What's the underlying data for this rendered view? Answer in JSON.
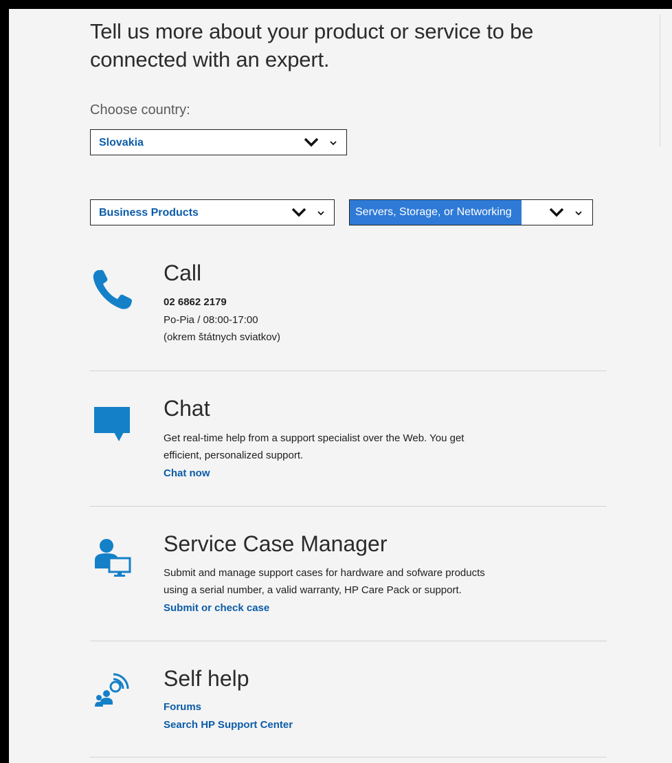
{
  "headline": "Tell us more about your product or service to be connected with an expert.",
  "country": {
    "label": "Choose country:",
    "selected": "Slovakia"
  },
  "product_select": {
    "selected": "Business Products"
  },
  "category_select": {
    "selected": "Servers, Storage, or Networking"
  },
  "call": {
    "title": "Call",
    "phone": "02 6862 2179",
    "hours": "Po-Pia / 08:00-17:00",
    "note": "(okrem štátnych sviatkov)",
    "icon": "phone-icon"
  },
  "chat": {
    "title": "Chat",
    "description_line1": "Get real-time help from a support specialist over the Web. You get",
    "description_line2": "efficient, personalized support.",
    "link": "Chat now",
    "icon": "chat-bubble-icon"
  },
  "service_case": {
    "title": "Service Case Manager",
    "description_line1": "Submit and manage support cases for hardware and sofware products",
    "description_line2": "using a serial number, a valid warranty, HP Care Pack or support.",
    "link": "Submit or check case",
    "icon": "user-computer-icon"
  },
  "self_help": {
    "title": "Self help",
    "link_forums": "Forums",
    "link_search": "Search HP Support Center",
    "icon": "community-icon"
  },
  "colors": {
    "accent_blue": "#0b5ca8",
    "icon_blue": "#1480c8",
    "highlight": "#2f7ad6"
  }
}
